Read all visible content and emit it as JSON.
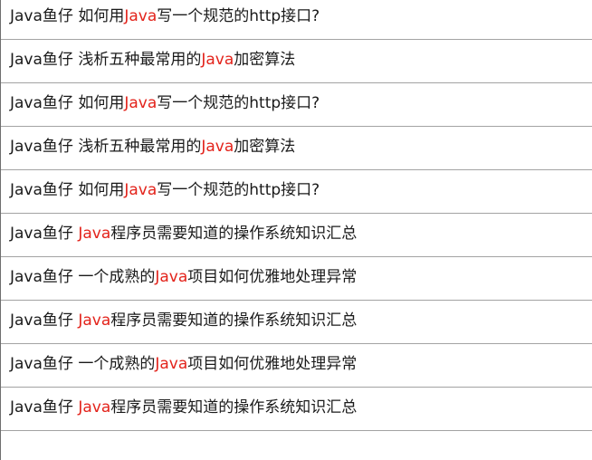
{
  "accent_color": "#e3231b",
  "results": [
    {
      "author": "Java鱼仔",
      "before": "如何用",
      "keyword": "Java",
      "after": "写一个规范的http接口?"
    },
    {
      "author": "Java鱼仔",
      "before": "浅析五种最常用的",
      "keyword": "Java",
      "after": "加密算法"
    },
    {
      "author": "Java鱼仔",
      "before": "如何用",
      "keyword": "Java",
      "after": "写一个规范的http接口?"
    },
    {
      "author": "Java鱼仔",
      "before": "浅析五种最常用的",
      "keyword": "Java",
      "after": "加密算法"
    },
    {
      "author": "Java鱼仔",
      "before": "如何用",
      "keyword": "Java",
      "after": "写一个规范的http接口?"
    },
    {
      "author": "Java鱼仔",
      "before": "",
      "keyword": "Java",
      "after": "程序员需要知道的操作系统知识汇总"
    },
    {
      "author": "Java鱼仔",
      "before": "一个成熟的",
      "keyword": "Java",
      "after": "项目如何优雅地处理异常"
    },
    {
      "author": "Java鱼仔",
      "before": "",
      "keyword": "Java",
      "after": "程序员需要知道的操作系统知识汇总"
    },
    {
      "author": "Java鱼仔",
      "before": "一个成熟的",
      "keyword": "Java",
      "after": "项目如何优雅地处理异常"
    },
    {
      "author": "Java鱼仔",
      "before": "",
      "keyword": "Java",
      "after": "程序员需要知道的操作系统知识汇总"
    }
  ]
}
